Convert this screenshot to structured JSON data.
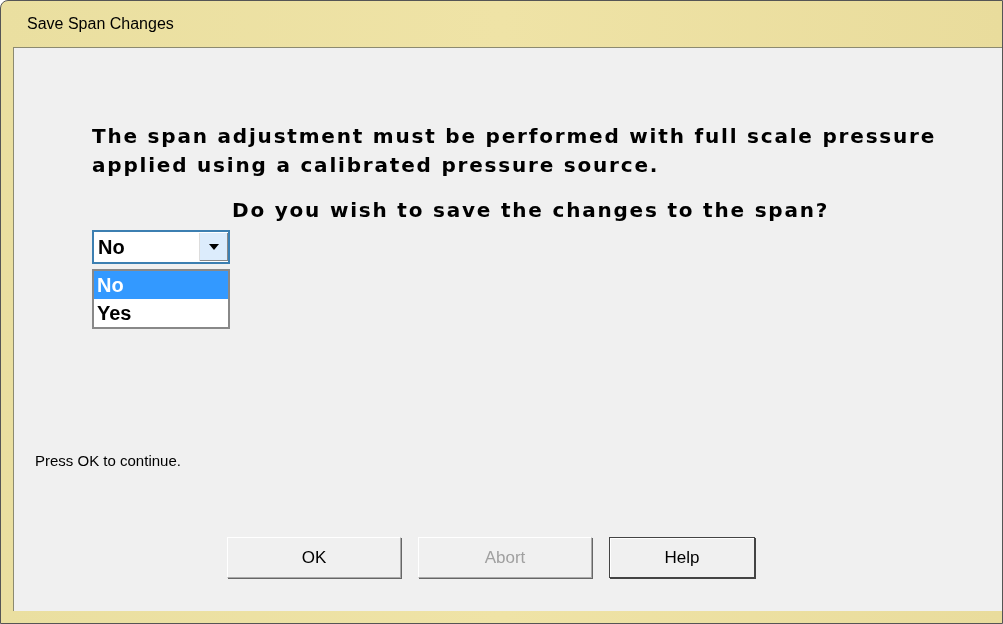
{
  "window": {
    "title": "Save Span Changes"
  },
  "message": "The span adjustment must be performed with full scale pressure applied using a calibrated pressure source.",
  "question": "Do you wish to save the changes to the span?",
  "dropdown": {
    "value": "No",
    "expanded": true,
    "options": [
      {
        "label": "No",
        "selected": true
      },
      {
        "label": "Yes",
        "selected": false
      }
    ]
  },
  "hint": "Press OK to continue.",
  "buttons": [
    {
      "label": "OK",
      "disabled": false,
      "default": false
    },
    {
      "label": "Abort",
      "disabled": true,
      "default": false
    },
    {
      "label": "Help",
      "disabled": false,
      "default": true
    }
  ]
}
